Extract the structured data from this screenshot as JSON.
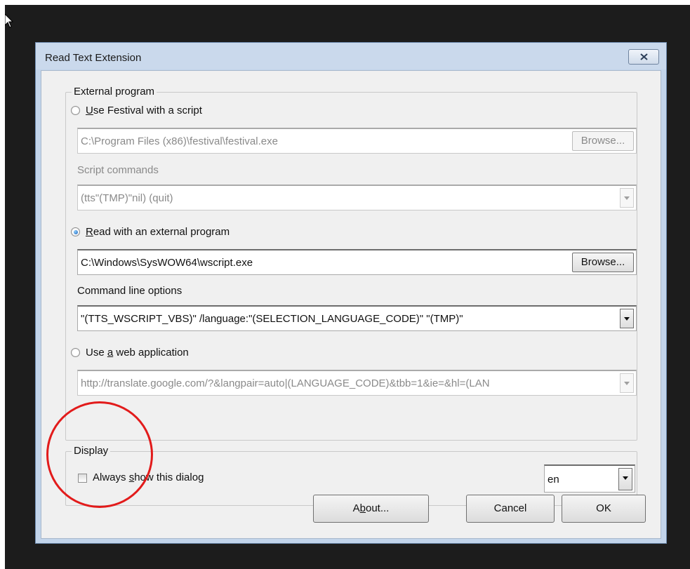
{
  "window": {
    "title": "Read Text Extension",
    "close_icon": "close-icon"
  },
  "external_program": {
    "legend": "External program",
    "festival": {
      "label_pre": "",
      "label_key": "U",
      "label_post": "se Festival with a script",
      "checked": false,
      "path": "C:\\Program Files (x86)\\festival\\festival.exe",
      "browse_label": "Browse...",
      "script_commands_label": "Script commands",
      "script_commands_value": "(tts\"(TMP)\"nil) (quit)"
    },
    "external": {
      "label_pre": "",
      "label_key": "R",
      "label_post": "ead with an external program",
      "checked": true,
      "path": "C:\\Windows\\SysWOW64\\wscript.exe",
      "browse_label": "Browse...",
      "cmd_label": "Command line options",
      "cmd_value": "\"(TTS_WSCRIPT_VBS)\" /language:\"(SELECTION_LANGUAGE_CODE)\" \"(TMP)\""
    },
    "web": {
      "label_pre": "Use ",
      "label_key": "a",
      "label_post": " web application",
      "checked": false,
      "url": "http://translate.google.com/?&langpair=auto|(LANGUAGE_CODE)&tbb=1&ie=&hl=(LAN"
    }
  },
  "display": {
    "legend": "Display",
    "always_show_pre": "Always ",
    "always_show_key": "s",
    "always_show_post": "how this dialog",
    "always_show_checked": false,
    "language_value": "en"
  },
  "buttons": {
    "about_pre": "A",
    "about_key": "b",
    "about_post": "out...",
    "cancel": "Cancel",
    "ok": "OK"
  },
  "colors": {
    "annotation_circle": "#e21b1b",
    "radio_selected": "#1c5fb5"
  }
}
